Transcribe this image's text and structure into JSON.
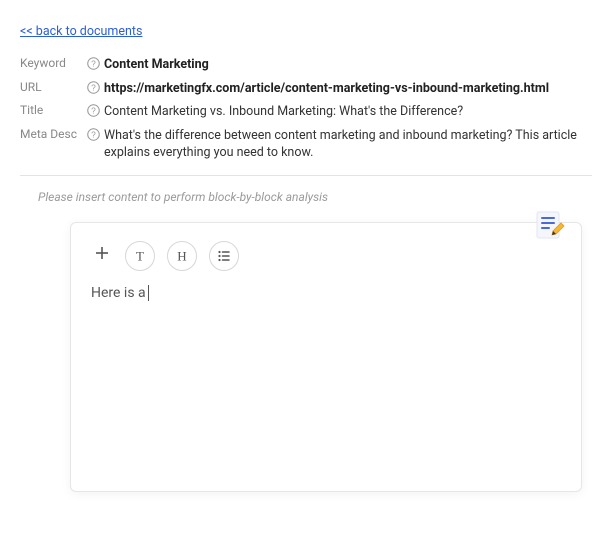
{
  "nav": {
    "back_label": "<< back to documents"
  },
  "meta": {
    "keyword": {
      "label": "Keyword",
      "value": "Content Marketing"
    },
    "url": {
      "label": "URL",
      "value": "https://marketingfx.com/article/content-marketing-vs-inbound-marketing.html"
    },
    "title": {
      "label": "Title",
      "value": "Content Marketing vs. Inbound Marketing: What's the Difference?"
    },
    "meta_desc": {
      "label": "Meta Desc",
      "value": "What's the difference between content marketing and inbound marketing? This article explains everything you need to know."
    }
  },
  "analysis_placeholder": "Please insert content to perform block-by-block analysis",
  "editor": {
    "content": "Here is a "
  }
}
